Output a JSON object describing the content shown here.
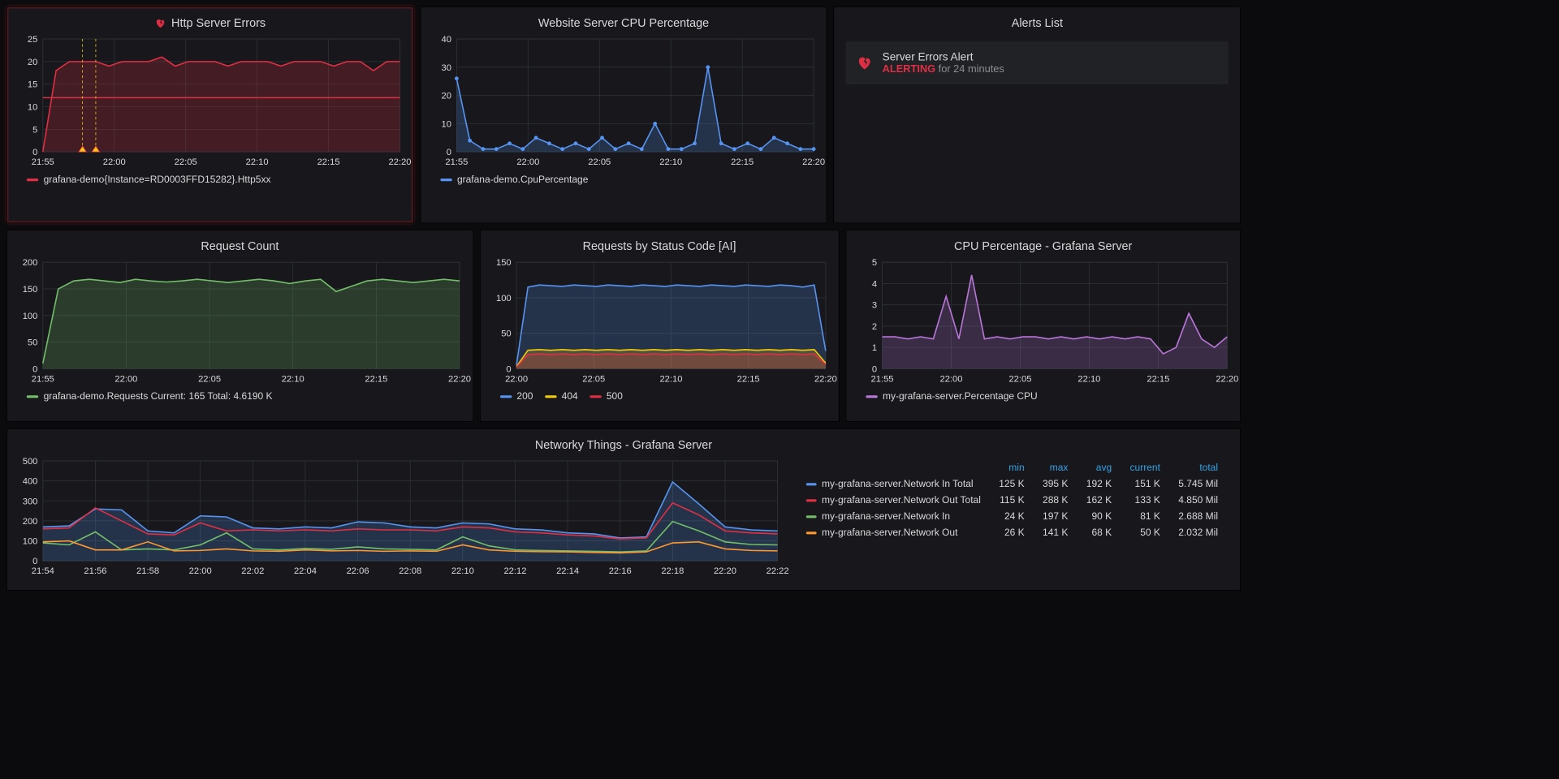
{
  "panels": {
    "http_errors": {
      "title": "Http Server Errors",
      "legend": "grafana-demo{Instance=RD0003FFD15282}.Http5xx",
      "threshold": 12
    },
    "cpu": {
      "title": "Website Server CPU Percentage",
      "legend": "grafana-demo.CpuPercentage"
    },
    "alerts": {
      "title": "Alerts List",
      "item": {
        "name": "Server Errors Alert",
        "state": "ALERTING",
        "for": "for 24 minutes"
      }
    },
    "reqs": {
      "title": "Request Count",
      "legend": "grafana-demo.Requests  Current: 165  Total: 4.6190 K"
    },
    "status": {
      "title": "Requests by Status Code [AI]",
      "legend": {
        "s200": "200",
        "s404": "404",
        "s500": "500"
      }
    },
    "cpu_gr": {
      "title": "CPU Percentage - Grafana Server",
      "legend": "my-grafana-server.Percentage CPU"
    },
    "net": {
      "title": "Networky Things - Grafana Server",
      "headers": {
        "min": "min",
        "max": "max",
        "avg": "avg",
        "current": "current",
        "total": "total"
      },
      "series": [
        {
          "name": "my-grafana-server.Network In Total",
          "color": "#5794f2",
          "min": "125 K",
          "max": "395 K",
          "avg": "192 K",
          "current": "151 K",
          "total": "5.745 Mil"
        },
        {
          "name": "my-grafana-server.Network Out Total",
          "color": "#e02f44",
          "min": "115 K",
          "max": "288 K",
          "avg": "162 K",
          "current": "133 K",
          "total": "4.850 Mil"
        },
        {
          "name": "my-grafana-server.Network In",
          "color": "#73bf69",
          "min": "24 K",
          "max": "197 K",
          "avg": "90 K",
          "current": "81 K",
          "total": "2.688 Mil"
        },
        {
          "name": "my-grafana-server.Network Out",
          "color": "#ff9830",
          "min": "26 K",
          "max": "141 K",
          "avg": "68 K",
          "current": "50 K",
          "total": "2.032 Mil"
        }
      ]
    }
  },
  "chart_data": [
    {
      "id": "http_errors",
      "type": "area",
      "xlabels": [
        "21:55",
        "22:00",
        "22:05",
        "22:10",
        "22:15",
        "22:20"
      ],
      "ylim": [
        0,
        25
      ],
      "yticks": [
        0,
        5,
        10,
        15,
        20,
        25
      ],
      "series": [
        {
          "name": "Http5xx",
          "color": "#e02f44",
          "fill": true,
          "values": [
            0,
            18,
            20,
            20,
            20,
            19,
            20,
            20,
            20,
            21,
            19,
            20,
            20,
            20,
            19,
            20,
            20,
            20,
            19,
            20,
            20,
            20,
            19,
            20,
            20,
            18,
            20,
            20
          ]
        }
      ],
      "n": 28,
      "threshold": 12,
      "markers_x": [
        3,
        4
      ]
    },
    {
      "id": "cpu",
      "type": "line",
      "xlabels": [
        "21:55",
        "22:00",
        "22:05",
        "22:10",
        "22:15",
        "22:20"
      ],
      "ylim": [
        0,
        40
      ],
      "yticks": [
        0,
        10,
        20,
        30,
        40
      ],
      "series": [
        {
          "name": "CpuPercentage",
          "color": "#5794f2",
          "fill": true,
          "dots": true,
          "values": [
            26,
            4,
            1,
            1,
            3,
            1,
            5,
            3,
            1,
            3,
            1,
            5,
            1,
            3,
            1,
            10,
            1,
            1,
            3,
            30,
            3,
            1,
            3,
            1,
            5,
            3,
            1,
            1
          ]
        }
      ],
      "n": 28
    },
    {
      "id": "reqs",
      "type": "area",
      "xlabels": [
        "21:55",
        "22:00",
        "22:05",
        "22:10",
        "22:15",
        "22:20"
      ],
      "ylim": [
        0,
        200
      ],
      "yticks": [
        0,
        50,
        100,
        150,
        200
      ],
      "series": [
        {
          "name": "Requests",
          "color": "#73bf69",
          "fill": true,
          "values": [
            10,
            150,
            165,
            168,
            165,
            162,
            168,
            165,
            163,
            165,
            168,
            165,
            162,
            165,
            168,
            165,
            160,
            165,
            168,
            145,
            155,
            165,
            168,
            165,
            162,
            165,
            168,
            165
          ]
        }
      ],
      "n": 28
    },
    {
      "id": "status",
      "type": "area",
      "xlabels": [
        "22:00",
        "22:05",
        "22:10",
        "22:15",
        "22:20"
      ],
      "ylim": [
        0,
        150
      ],
      "yticks": [
        0,
        50,
        100,
        150
      ],
      "series": [
        {
          "name": "200",
          "color": "#5794f2",
          "fill": true,
          "values": [
            5,
            115,
            118,
            117,
            116,
            118,
            117,
            116,
            118,
            117,
            116,
            118,
            117,
            116,
            118,
            117,
            116,
            118,
            117,
            116,
            118,
            117,
            116,
            118,
            117,
            115,
            118,
            25
          ]
        },
        {
          "name": "404",
          "color": "#f2cc0c",
          "fill": true,
          "values": [
            3,
            26,
            27,
            26,
            27,
            26,
            27,
            26,
            27,
            26,
            27,
            26,
            27,
            26,
            27,
            26,
            27,
            26,
            27,
            26,
            27,
            26,
            27,
            26,
            27,
            26,
            27,
            8
          ]
        },
        {
          "name": "500",
          "color": "#e02f44",
          "fill": true,
          "values": [
            2,
            20,
            21,
            20,
            21,
            20,
            21,
            20,
            21,
            20,
            21,
            20,
            21,
            20,
            21,
            20,
            21,
            20,
            21,
            20,
            21,
            20,
            21,
            20,
            21,
            20,
            21,
            6
          ]
        }
      ],
      "n": 28
    },
    {
      "id": "cpu_gr",
      "type": "area",
      "xlabels": [
        "21:55",
        "22:00",
        "22:05",
        "22:10",
        "22:15",
        "22:20"
      ],
      "ylim": [
        0,
        5
      ],
      "yticks": [
        0,
        1,
        2,
        3,
        4,
        5
      ],
      "series": [
        {
          "name": "Percentage CPU",
          "color": "#b877d9",
          "fill": true,
          "values": [
            1.5,
            1.5,
            1.4,
            1.5,
            1.4,
            3.4,
            1.4,
            4.4,
            1.4,
            1.5,
            1.4,
            1.5,
            1.5,
            1.4,
            1.5,
            1.4,
            1.5,
            1.4,
            1.5,
            1.4,
            1.5,
            1.4,
            0.7,
            1.0,
            2.6,
            1.4,
            1.0,
            1.5
          ]
        }
      ],
      "n": 28
    },
    {
      "id": "net",
      "type": "area",
      "xlabels": [
        "21:54",
        "21:56",
        "21:58",
        "22:00",
        "22:02",
        "22:04",
        "22:06",
        "22:08",
        "22:10",
        "22:12",
        "22:14",
        "22:16",
        "22:18",
        "22:20",
        "22:22"
      ],
      "ylim": [
        0,
        500
      ],
      "yticks": [
        0,
        100,
        200,
        300,
        400,
        500
      ],
      "series": [
        {
          "name": "Network In Total",
          "color": "#5794f2",
          "fill": true,
          "values": [
            170,
            175,
            260,
            255,
            150,
            140,
            225,
            220,
            165,
            160,
            170,
            165,
            195,
            190,
            170,
            165,
            190,
            185,
            160,
            155,
            140,
            135,
            115,
            120,
            395,
            285,
            170,
            155,
            150
          ]
        },
        {
          "name": "Network Out Total",
          "color": "#e02f44",
          "fill": false,
          "values": [
            160,
            165,
            265,
            200,
            135,
            130,
            190,
            150,
            155,
            150,
            155,
            150,
            160,
            155,
            155,
            150,
            170,
            165,
            145,
            140,
            130,
            125,
            110,
            115,
            290,
            230,
            150,
            140,
            135
          ]
        },
        {
          "name": "Network In",
          "color": "#73bf69",
          "fill": false,
          "values": [
            90,
            80,
            145,
            55,
            60,
            55,
            80,
            140,
            60,
            55,
            62,
            58,
            70,
            60,
            58,
            55,
            120,
            75,
            55,
            52,
            50,
            48,
            45,
            50,
            197,
            150,
            95,
            82,
            80
          ]
        },
        {
          "name": "Network Out",
          "color": "#ff9830",
          "fill": false,
          "values": [
            95,
            100,
            55,
            55,
            95,
            50,
            52,
            60,
            50,
            48,
            55,
            50,
            52,
            48,
            50,
            48,
            80,
            55,
            48,
            46,
            45,
            42,
            40,
            45,
            90,
            95,
            60,
            52,
            50
          ]
        }
      ],
      "n": 29
    }
  ]
}
